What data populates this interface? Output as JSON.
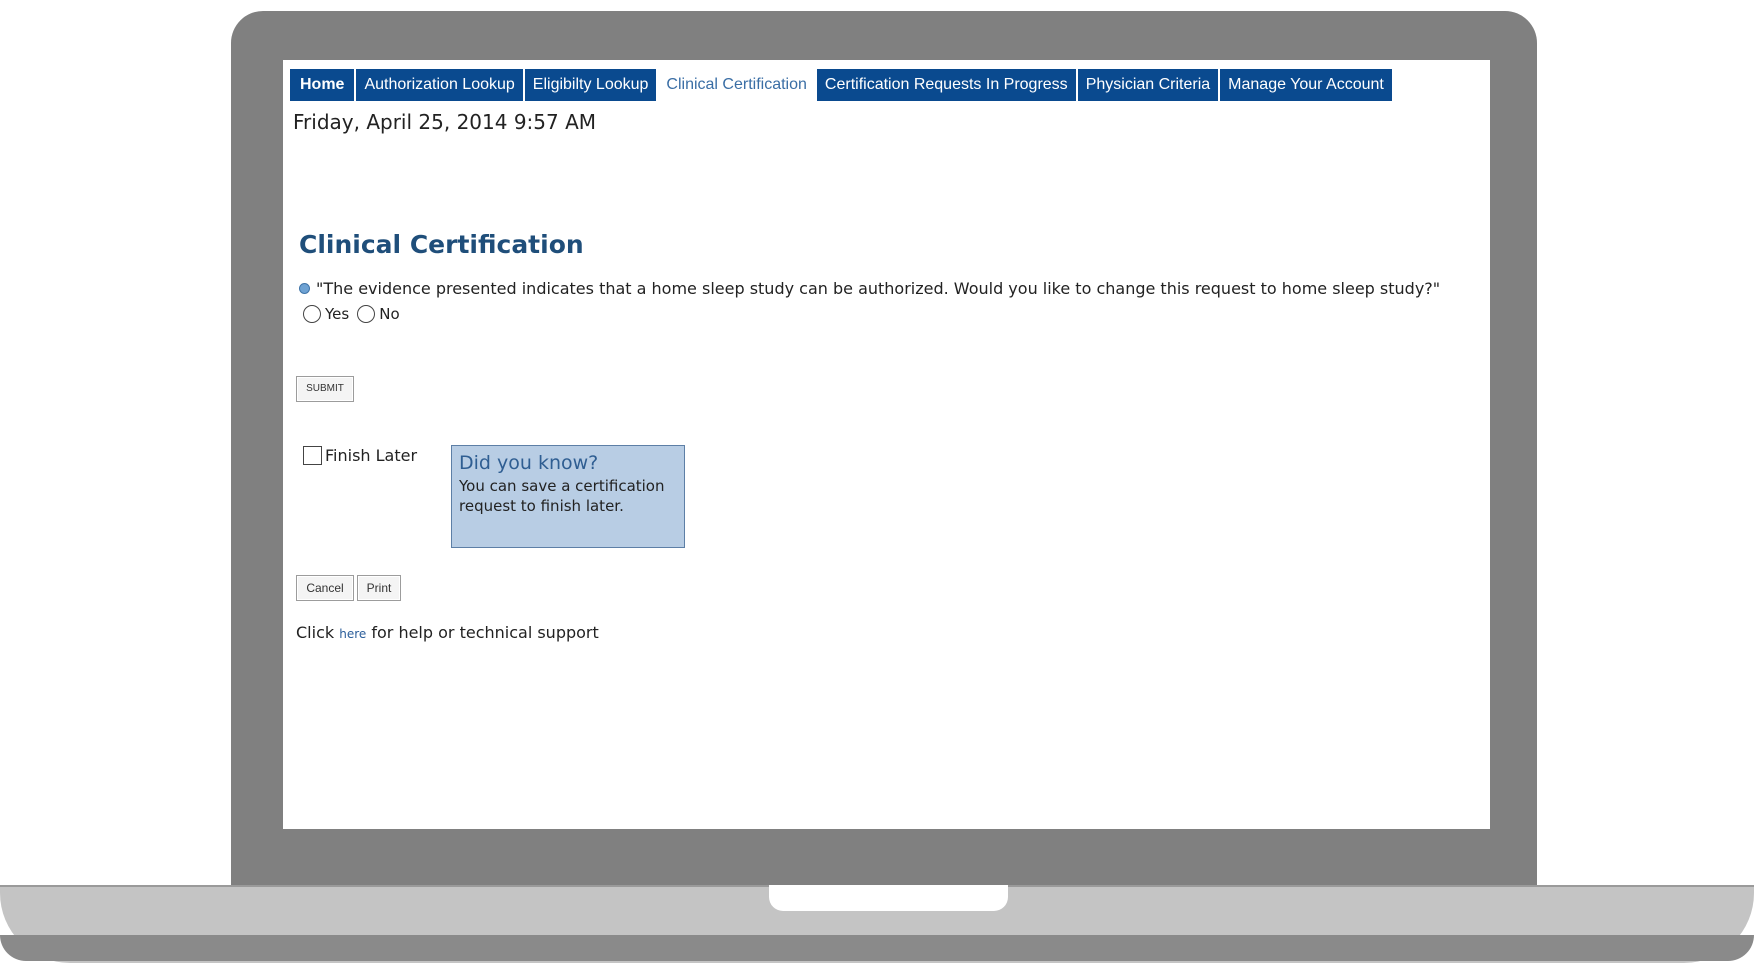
{
  "nav": {
    "tabs": [
      {
        "label": "Home"
      },
      {
        "label": "Authorization Lookup"
      },
      {
        "label": "Eligibilty Lookup"
      },
      {
        "label": "Clinical Certification"
      },
      {
        "label": "Certification Requests In Progress"
      },
      {
        "label": "Physician Criteria"
      },
      {
        "label": "Manage Your Account"
      }
    ]
  },
  "datetime": "Friday, April 25, 2014 9:57 AM",
  "page": {
    "title": "Clinical Certification",
    "question": "\"The evidence presented indicates that a home sleep study can be authorized. Would you like to change this request to home sleep study?\"",
    "options": {
      "yes": "Yes",
      "no": "No"
    },
    "submit_label": "SUBMIT",
    "finish_later_label": "Finish Later",
    "tip": {
      "title": "Did you know?",
      "body": "You can save a certification request to finish later."
    },
    "cancel_label": "Cancel",
    "print_label": "Print",
    "help": {
      "prefix": "Click",
      "link": "here",
      "suffix": "for help or technical support"
    }
  },
  "colors": {
    "nav_bg": "#0a4a8f",
    "title": "#1f4e7a",
    "tip_bg": "#b8cde4",
    "frame": "#808080"
  }
}
